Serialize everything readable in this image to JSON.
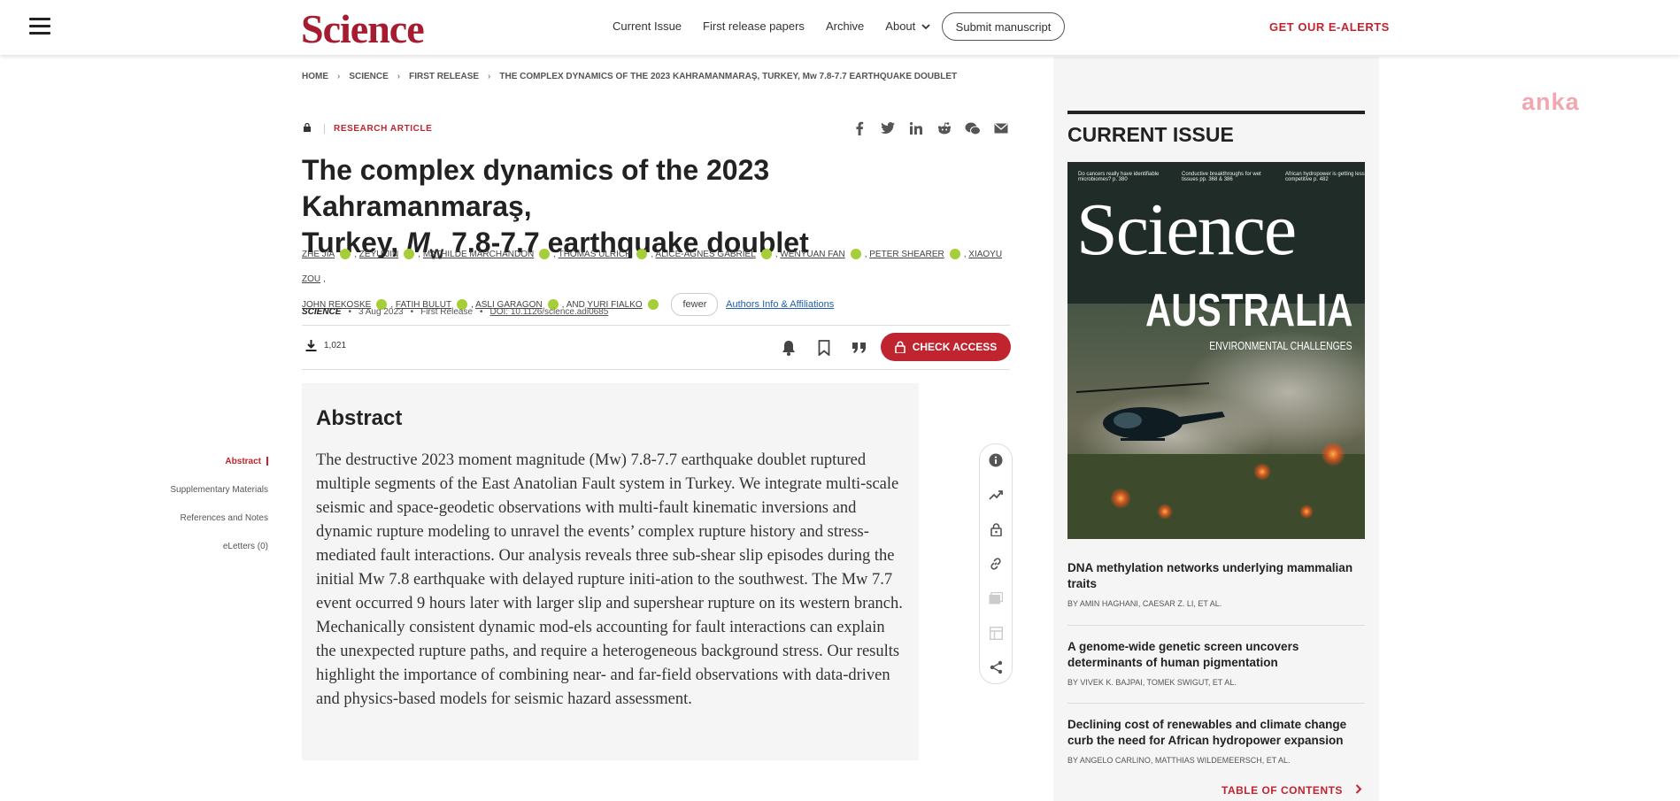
{
  "header": {
    "logo": "Science",
    "nav": [
      "Current Issue",
      "First release papers",
      "Archive",
      "About"
    ],
    "submit": "Submit manuscript",
    "alerts": "GET OUR E-ALERTS"
  },
  "breadcrumb": [
    "HOME",
    "SCIENCE",
    "FIRST RELEASE",
    "THE COMPLEX DYNAMICS OF THE 2023 KAHRAMANMARAŞ, TURKEY, Mw 7.8-7.7 EARTHQUAKE DOUBLET"
  ],
  "article": {
    "type": "RESEARCH ARTICLE",
    "title_line1": "The complex dynamics of the 2023 Kahramanmaraş,",
    "title_line2_a": "Turkey, ",
    "title_m": "M",
    "title_w": "w",
    "title_line2_b": " 7.8-7.7 earthquake doublet",
    "authors": [
      "ZHE JIA",
      "ZEYU JIN",
      "MATHILDE MARCHANDON",
      "THOMAS ULRICH",
      "ALICE-AGNES GABRIEL",
      "WENYUAN FAN",
      "PETER SHEARER",
      "XIAOYU ZOU",
      "JOHN REKOSKE",
      "FATIH BULUT",
      "ASLI GARAGON",
      "YURI FIALKO"
    ],
    "and": "AND",
    "fewer": "fewer",
    "affiliations": "Authors Info & Affiliations",
    "journal": "SCIENCE",
    "date": "3 Aug 2023",
    "release": "First Release",
    "doi": "DOI: 10.1126/science.adi0685",
    "downloads": "1,021",
    "check_access": "CHECK ACCESS"
  },
  "side_nav": [
    "Abstract",
    "Supplementary Materials",
    "References and Notes",
    "eLetters (0)"
  ],
  "abstract": {
    "heading": "Abstract",
    "text": "The destructive 2023 moment magnitude (Mw) 7.8-7.7 earthquake doublet ruptured multiple segments of the East Anatolian Fault system in Turkey. We integrate multi-scale seismic and space-geodetic observations with multi-fault kinematic inversions and dynamic rupture modeling to unravel the events’ complex rupture history and stress-mediated fault interactions. Our analysis reveals three sub-shear slip episodes during the initial Mw 7.8 earthquake with delayed rupture initi-ation to the southwest. The Mw 7.7 event occurred 9 hours later with larger slip and supershear rupture on its western branch. Mechanically consistent dynamic mod-els accounting for fault interactions can explain the unexpected rupture paths, and require a heterogeneous background stress. Our results highlight the importance of combining near- and far-field observations with data-driven and physics-based models for seismic hazard assessment."
  },
  "current_issue": {
    "heading": "CURRENT ISSUE",
    "cover_teasers": [
      "Do cancers really have identifiable microbiomes? p. 380",
      "Conductive breakthroughs for wet tissues pp. 368 & 386",
      "African hydropower is getting less competitive p. 482"
    ],
    "cover_logo": "Science",
    "cover_headline": "AUSTRALIA",
    "cover_sub": "ENVIRONMENTAL CHALLENGES",
    "items": [
      {
        "title": "DNA methylation networks underlying mammalian traits",
        "authors": "BY AMIN HAGHANI, CAESAR Z. LI, ET AL."
      },
      {
        "title": "A genome-wide genetic screen uncovers determinants of human pigmentation",
        "authors": "BY VIVEK K. BAJPAI, TOMEK SWIGUT, ET AL."
      },
      {
        "title": "Declining cost of renewables and climate change curb the need for African hydropower expansion",
        "authors": "BY ANGELO CARLINO, MATTHIAS WILDEMEERSCH, ET AL."
      }
    ],
    "toc": "TABLE OF CONTENTS"
  },
  "ad": {
    "logo": "anka"
  },
  "colors": {
    "brand": "#c0242e",
    "orcid": "#a6ce39",
    "link": "#1d5fb0"
  }
}
